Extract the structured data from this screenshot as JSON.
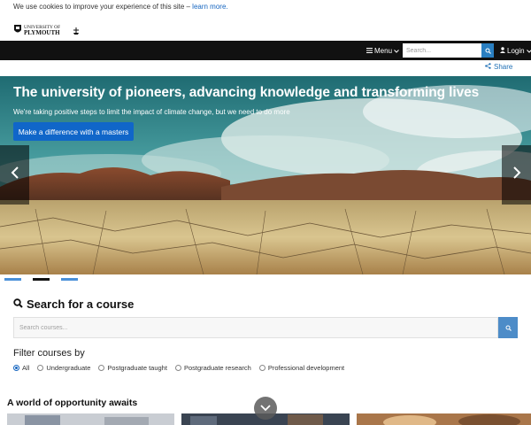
{
  "cookie": {
    "text": "We use cookies to improve your experience of this site – ",
    "link": "learn more."
  },
  "logo": {
    "line1": "UNIVERSITY OF",
    "line2": "PLYMOUTH"
  },
  "nav": {
    "menu_label": "Menu",
    "search_placeholder": "Search...",
    "login_label": "Login"
  },
  "share_label": "Share",
  "hero": {
    "title": "The university of pioneers, advancing knowledge and transforming lives",
    "subtitle": "We're taking positive steps to limit the impact of climate change, but we need to do more",
    "cta": "Make a difference with a masters",
    "slides": [
      {
        "active": false
      },
      {
        "active": true
      },
      {
        "active": false
      }
    ]
  },
  "course_search": {
    "heading": "Search for a course",
    "placeholder": "Search courses...",
    "filter_heading": "Filter courses by",
    "filters": [
      {
        "label": "All",
        "checked": true
      },
      {
        "label": "Undergraduate",
        "checked": false
      },
      {
        "label": "Postgraduate taught",
        "checked": false
      },
      {
        "label": "Postgraduate research",
        "checked": false
      },
      {
        "label": "Professional development",
        "checked": false
      }
    ]
  },
  "opportunity_heading": "A world of opportunity awaits",
  "colors": {
    "navbar": "#111111",
    "accent_blue": "#1066c9",
    "search_button": "#2a7fc1"
  }
}
